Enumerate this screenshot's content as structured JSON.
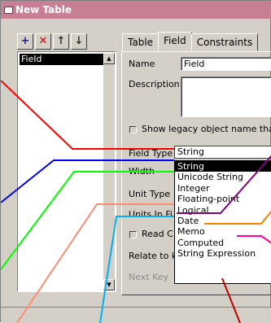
{
  "window": {
    "title": "New Table"
  },
  "toolbar": {
    "buttons": [
      {
        "name": "add-field",
        "glyph": "+"
      },
      {
        "name": "delete-field",
        "glyph": "✕"
      },
      {
        "name": "move-up",
        "glyph": "↑"
      },
      {
        "name": "move-down",
        "glyph": "↓"
      }
    ]
  },
  "field_list": {
    "items": [
      "Field"
    ],
    "selected": "Field"
  },
  "tabs": [
    "Table",
    "Field",
    "Constraints"
  ],
  "active_tab": "Field",
  "form": {
    "name_label": "Name",
    "name_value": "Field",
    "description_label": "Description",
    "legacy_label": "Show legacy object name tha",
    "field_type_label": "Field Type",
    "field_type_value": "String",
    "width_label": "Width",
    "unit_type_label": "Unit Type",
    "units_label": "Units In Fi",
    "read_only_label": "Read C",
    "relate_label": "Relate to k",
    "next_key_label": "Next Key"
  },
  "dropdown": {
    "options": [
      "String",
      "Unicode String",
      "Integer",
      "Floating-point",
      "Logical",
      "Date",
      "Memo",
      "Computed",
      "String Expression"
    ],
    "selected": "String"
  },
  "colors": {
    "titlebar": "#c77f93",
    "red": "#ff0000",
    "blue": "#0000ff",
    "green": "#00ff00",
    "purple": "#800080",
    "orange": "#ff8000",
    "magenta": "#ff00a0",
    "salmon": "#ff8c70",
    "cyan": "#00b0f0",
    "darkred": "#c00000"
  }
}
